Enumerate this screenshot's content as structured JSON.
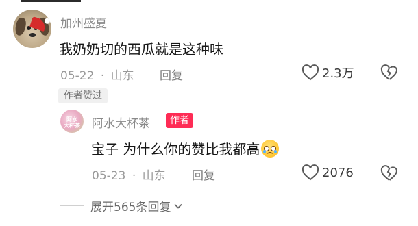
{
  "comments": [
    {
      "username": "加州盛夏",
      "text": "我奶奶切的西瓜就是这种味",
      "date": "05-22",
      "separator": "·",
      "location": "山东",
      "reply_label": "回复",
      "like_count": "2.3万",
      "badge": "作者赞过"
    },
    {
      "username": "阿水大杯茶",
      "author_tag": "作者",
      "avatar_text": "阿水\n大杯茶",
      "text": "宝子 为什么你的赞比我都高",
      "emoji": "crying-face",
      "date": "05-23",
      "separator": "·",
      "location": "山东",
      "reply_label": "回复",
      "like_count": "2076"
    }
  ],
  "expand_replies": "展开565条回复",
  "colors": {
    "author_tag_bg": "#fe2c55",
    "text_primary": "#161616",
    "text_muted": "#9a9a9a"
  }
}
